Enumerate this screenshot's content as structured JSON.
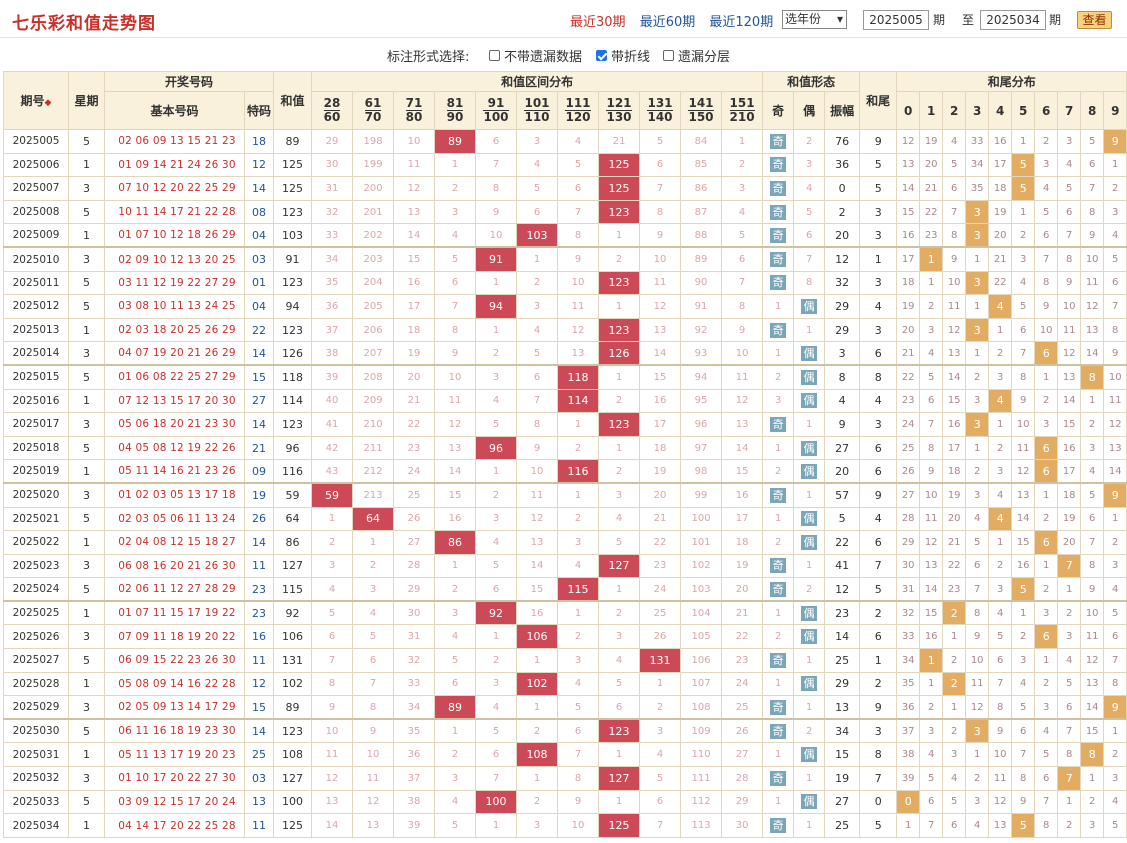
{
  "header": {
    "title": "七乐彩和值走势图",
    "periods": [
      "最近30期",
      "最近60期",
      "最近120期"
    ],
    "active_period": 0,
    "year_select": "选年份",
    "from_value": "2025005",
    "from_unit": "期",
    "to_label": "至",
    "to_value": "2025034",
    "to_unit": "期",
    "query_button": "查看"
  },
  "options": {
    "label": "标注形式选择:",
    "items": [
      {
        "label": "不带遗漏数据",
        "checked": false
      },
      {
        "label": "带折线",
        "checked": true
      },
      {
        "label": "遗漏分层",
        "checked": false
      }
    ]
  },
  "table_headers": {
    "issue": "期号",
    "week": "星期",
    "draw": "开奖号码",
    "basic": "基本号码",
    "special": "特码",
    "sum": "和值",
    "range_dist": "和值区间分布",
    "ranges": [
      [
        "28",
        "60"
      ],
      [
        "61",
        "70"
      ],
      [
        "71",
        "80"
      ],
      [
        "81",
        "90"
      ],
      [
        "91",
        "100"
      ],
      [
        "101",
        "110"
      ],
      [
        "111",
        "120"
      ],
      [
        "121",
        "130"
      ],
      [
        "131",
        "140"
      ],
      [
        "141",
        "150"
      ],
      [
        "151",
        "210"
      ]
    ],
    "form": "和值形态",
    "odd": "奇",
    "even": "偶",
    "amp": "振幅",
    "tail": "和尾",
    "tail_dist": "和尾分布",
    "tail_digits": [
      "0",
      "1",
      "2",
      "3",
      "4",
      "5",
      "6",
      "7",
      "8",
      "9"
    ]
  },
  "rows": [
    {
      "issue": "2025005",
      "week": "5",
      "nums": "02 06 09 13 15 21 23",
      "sp": "18",
      "sum": "89",
      "hit": 3,
      "ranges": [
        "29",
        "198",
        "10",
        "89",
        "6",
        "3",
        "4",
        "21",
        "5",
        "84",
        "1"
      ],
      "odd": "奇",
      "even_m": "2",
      "oe": "odd",
      "amp": "76",
      "tail": "9",
      "tails": [
        "12",
        "19",
        "4",
        "33",
        "16",
        "1",
        "2",
        "3",
        "5",
        "9"
      ]
    },
    {
      "issue": "2025006",
      "week": "1",
      "nums": "01 09 14 21 24 26 30",
      "sp": "12",
      "sum": "125",
      "hit": 7,
      "ranges": [
        "30",
        "199",
        "11",
        "1",
        "7",
        "4",
        "5",
        "125",
        "6",
        "85",
        "2"
      ],
      "odd": "奇",
      "even_m": "3",
      "oe": "odd",
      "amp": "36",
      "tail": "5",
      "tails": [
        "13",
        "20",
        "5",
        "34",
        "17",
        "5",
        "3",
        "4",
        "6",
        "1"
      ]
    },
    {
      "issue": "2025007",
      "week": "3",
      "nums": "07 10 12 20 22 25 29",
      "sp": "14",
      "sum": "125",
      "hit": 7,
      "ranges": [
        "31",
        "200",
        "12",
        "2",
        "8",
        "5",
        "6",
        "125",
        "7",
        "86",
        "3"
      ],
      "odd": "奇",
      "even_m": "4",
      "oe": "odd",
      "amp": "0",
      "tail": "5",
      "tails": [
        "14",
        "21",
        "6",
        "35",
        "18",
        "5",
        "4",
        "5",
        "7",
        "2"
      ]
    },
    {
      "issue": "2025008",
      "week": "5",
      "nums": "10 11 14 17 21 22 28",
      "sp": "08",
      "sum": "123",
      "hit": 7,
      "ranges": [
        "32",
        "201",
        "13",
        "3",
        "9",
        "6",
        "7",
        "123",
        "8",
        "87",
        "4"
      ],
      "odd": "奇",
      "even_m": "5",
      "oe": "odd",
      "amp": "2",
      "tail": "3",
      "tails": [
        "15",
        "22",
        "7",
        "3",
        "19",
        "1",
        "5",
        "6",
        "8",
        "3"
      ]
    },
    {
      "issue": "2025009",
      "week": "1",
      "nums": "01 07 10 12 18 26 29",
      "sp": "04",
      "sum": "103",
      "hit": 5,
      "ranges": [
        "33",
        "202",
        "14",
        "4",
        "10",
        "103",
        "8",
        "1",
        "9",
        "88",
        "5"
      ],
      "odd": "奇",
      "even_m": "6",
      "oe": "odd",
      "amp": "20",
      "tail": "3",
      "tails": [
        "16",
        "23",
        "8",
        "3",
        "20",
        "2",
        "6",
        "7",
        "9",
        "4"
      ]
    },
    {
      "issue": "2025010",
      "week": "3",
      "nums": "02 09 10 12 13 20 25",
      "sp": "03",
      "sum": "91",
      "hit": 4,
      "ranges": [
        "34",
        "203",
        "15",
        "5",
        "91",
        "1",
        "9",
        "2",
        "10",
        "89",
        "6"
      ],
      "odd": "奇",
      "even_m": "7",
      "oe": "odd",
      "amp": "12",
      "tail": "1",
      "tails": [
        "17",
        "1",
        "9",
        "1",
        "21",
        "3",
        "7",
        "8",
        "10",
        "5"
      ]
    },
    {
      "issue": "2025011",
      "week": "5",
      "nums": "03 11 12 19 22 27 29",
      "sp": "01",
      "sum": "123",
      "hit": 7,
      "ranges": [
        "35",
        "204",
        "16",
        "6",
        "1",
        "2",
        "10",
        "123",
        "11",
        "90",
        "7"
      ],
      "odd": "奇",
      "even_m": "8",
      "oe": "odd",
      "amp": "32",
      "tail": "3",
      "tails": [
        "18",
        "1",
        "10",
        "3",
        "22",
        "4",
        "8",
        "9",
        "11",
        "6"
      ]
    },
    {
      "issue": "2025012",
      "week": "5",
      "nums": "03 08 10 11 13 24 25",
      "sp": "04",
      "sum": "94",
      "hit": 4,
      "ranges": [
        "36",
        "205",
        "17",
        "7",
        "94",
        "3",
        "11",
        "1",
        "12",
        "91",
        "8"
      ],
      "odd": "1",
      "even_m": "偶",
      "oe": "even",
      "amp": "29",
      "tail": "4",
      "tails": [
        "19",
        "2",
        "11",
        "1",
        "4",
        "5",
        "9",
        "10",
        "12",
        "7"
      ]
    },
    {
      "issue": "2025013",
      "week": "1",
      "nums": "02 03 18 20 25 26 29",
      "sp": "22",
      "sum": "123",
      "hit": 7,
      "ranges": [
        "37",
        "206",
        "18",
        "8",
        "1",
        "4",
        "12",
        "123",
        "13",
        "92",
        "9"
      ],
      "odd": "奇",
      "even_m": "1",
      "oe": "odd",
      "amp": "29",
      "tail": "3",
      "tails": [
        "20",
        "3",
        "12",
        "3",
        "1",
        "6",
        "10",
        "11",
        "13",
        "8"
      ]
    },
    {
      "issue": "2025014",
      "week": "3",
      "nums": "04 07 19 20 21 26 29",
      "sp": "14",
      "sum": "126",
      "hit": 7,
      "ranges": [
        "38",
        "207",
        "19",
        "9",
        "2",
        "5",
        "13",
        "126",
        "14",
        "93",
        "10"
      ],
      "odd": "1",
      "even_m": "偶",
      "oe": "even",
      "amp": "3",
      "tail": "6",
      "tails": [
        "21",
        "4",
        "13",
        "1",
        "2",
        "7",
        "6",
        "12",
        "14",
        "9"
      ]
    },
    {
      "issue": "2025015",
      "week": "5",
      "nums": "01 06 08 22 25 27 29",
      "sp": "15",
      "sum": "118",
      "hit": 6,
      "ranges": [
        "39",
        "208",
        "20",
        "10",
        "3",
        "6",
        "118",
        "1",
        "15",
        "94",
        "11"
      ],
      "odd": "2",
      "even_m": "偶",
      "oe": "even",
      "amp": "8",
      "tail": "8",
      "tails": [
        "22",
        "5",
        "14",
        "2",
        "3",
        "8",
        "1",
        "13",
        "8",
        "10"
      ]
    },
    {
      "issue": "2025016",
      "week": "1",
      "nums": "07 12 13 15 17 20 30",
      "sp": "27",
      "sum": "114",
      "hit": 6,
      "ranges": [
        "40",
        "209",
        "21",
        "11",
        "4",
        "7",
        "114",
        "2",
        "16",
        "95",
        "12"
      ],
      "odd": "3",
      "even_m": "偶",
      "oe": "even",
      "amp": "4",
      "tail": "4",
      "tails": [
        "23",
        "6",
        "15",
        "3",
        "4",
        "9",
        "2",
        "14",
        "1",
        "11"
      ]
    },
    {
      "issue": "2025017",
      "week": "3",
      "nums": "05 06 18 20 21 23 30",
      "sp": "14",
      "sum": "123",
      "hit": 7,
      "ranges": [
        "41",
        "210",
        "22",
        "12",
        "5",
        "8",
        "1",
        "123",
        "17",
        "96",
        "13"
      ],
      "odd": "奇",
      "even_m": "1",
      "oe": "odd",
      "amp": "9",
      "tail": "3",
      "tails": [
        "24",
        "7",
        "16",
        "3",
        "1",
        "10",
        "3",
        "15",
        "2",
        "12"
      ]
    },
    {
      "issue": "2025018",
      "week": "5",
      "nums": "04 05 08 12 19 22 26",
      "sp": "21",
      "sum": "96",
      "hit": 4,
      "ranges": [
        "42",
        "211",
        "23",
        "13",
        "96",
        "9",
        "2",
        "1",
        "18",
        "97",
        "14"
      ],
      "odd": "1",
      "even_m": "偶",
      "oe": "even",
      "amp": "27",
      "tail": "6",
      "tails": [
        "25",
        "8",
        "17",
        "1",
        "2",
        "11",
        "6",
        "16",
        "3",
        "13"
      ]
    },
    {
      "issue": "2025019",
      "week": "1",
      "nums": "05 11 14 16 21 23 26",
      "sp": "09",
      "sum": "116",
      "hit": 6,
      "ranges": [
        "43",
        "212",
        "24",
        "14",
        "1",
        "10",
        "116",
        "2",
        "19",
        "98",
        "15"
      ],
      "odd": "2",
      "even_m": "偶",
      "oe": "even",
      "amp": "20",
      "tail": "6",
      "tails": [
        "26",
        "9",
        "18",
        "2",
        "3",
        "12",
        "6",
        "17",
        "4",
        "14"
      ]
    },
    {
      "issue": "2025020",
      "week": "3",
      "nums": "01 02 03 05 13 17 18",
      "sp": "19",
      "sum": "59",
      "hit": 0,
      "ranges": [
        "59",
        "213",
        "25",
        "15",
        "2",
        "11",
        "1",
        "3",
        "20",
        "99",
        "16"
      ],
      "odd": "奇",
      "even_m": "1",
      "oe": "odd",
      "amp": "57",
      "tail": "9",
      "tails": [
        "27",
        "10",
        "19",
        "3",
        "4",
        "13",
        "1",
        "18",
        "5",
        "9"
      ]
    },
    {
      "issue": "2025021",
      "week": "5",
      "nums": "02 03 05 06 11 13 24",
      "sp": "26",
      "sum": "64",
      "hit": 1,
      "ranges": [
        "1",
        "64",
        "26",
        "16",
        "3",
        "12",
        "2",
        "4",
        "21",
        "100",
        "17"
      ],
      "odd": "1",
      "even_m": "偶",
      "oe": "even",
      "amp": "5",
      "tail": "4",
      "tails": [
        "28",
        "11",
        "20",
        "4",
        "4",
        "14",
        "2",
        "19",
        "6",
        "1"
      ]
    },
    {
      "issue": "2025022",
      "week": "1",
      "nums": "02 04 08 12 15 18 27",
      "sp": "14",
      "sum": "86",
      "hit": 3,
      "ranges": [
        "2",
        "1",
        "27",
        "86",
        "4",
        "13",
        "3",
        "5",
        "22",
        "101",
        "18"
      ],
      "odd": "2",
      "even_m": "偶",
      "oe": "even",
      "amp": "22",
      "tail": "6",
      "tails": [
        "29",
        "12",
        "21",
        "5",
        "1",
        "15",
        "6",
        "20",
        "7",
        "2"
      ]
    },
    {
      "issue": "2025023",
      "week": "3",
      "nums": "06 08 16 20 21 26 30",
      "sp": "11",
      "sum": "127",
      "hit": 7,
      "ranges": [
        "3",
        "2",
        "28",
        "1",
        "5",
        "14",
        "4",
        "127",
        "23",
        "102",
        "19"
      ],
      "odd": "奇",
      "even_m": "1",
      "oe": "odd",
      "amp": "41",
      "tail": "7",
      "tails": [
        "30",
        "13",
        "22",
        "6",
        "2",
        "16",
        "1",
        "7",
        "8",
        "3"
      ]
    },
    {
      "issue": "2025024",
      "week": "5",
      "nums": "02 06 11 12 27 28 29",
      "sp": "23",
      "sum": "115",
      "hit": 6,
      "ranges": [
        "4",
        "3",
        "29",
        "2",
        "6",
        "15",
        "115",
        "1",
        "24",
        "103",
        "20"
      ],
      "odd": "奇",
      "even_m": "2",
      "oe": "odd",
      "amp": "12",
      "tail": "5",
      "tails": [
        "31",
        "14",
        "23",
        "7",
        "3",
        "5",
        "2",
        "1",
        "9",
        "4"
      ]
    },
    {
      "issue": "2025025",
      "week": "1",
      "nums": "01 07 11 15 17 19 22",
      "sp": "23",
      "sum": "92",
      "hit": 4,
      "ranges": [
        "5",
        "4",
        "30",
        "3",
        "92",
        "16",
        "1",
        "2",
        "25",
        "104",
        "21"
      ],
      "odd": "1",
      "even_m": "偶",
      "oe": "even",
      "amp": "23",
      "tail": "2",
      "tails": [
        "32",
        "15",
        "2",
        "8",
        "4",
        "1",
        "3",
        "2",
        "10",
        "5"
      ]
    },
    {
      "issue": "2025026",
      "week": "3",
      "nums": "07 09 11 18 19 20 22",
      "sp": "16",
      "sum": "106",
      "hit": 5,
      "ranges": [
        "6",
        "5",
        "31",
        "4",
        "1",
        "106",
        "2",
        "3",
        "26",
        "105",
        "22"
      ],
      "odd": "2",
      "even_m": "偶",
      "oe": "even",
      "amp": "14",
      "tail": "6",
      "tails": [
        "33",
        "16",
        "1",
        "9",
        "5",
        "2",
        "6",
        "3",
        "11",
        "6"
      ]
    },
    {
      "issue": "2025027",
      "week": "5",
      "nums": "06 09 15 22 23 26 30",
      "sp": "11",
      "sum": "131",
      "hit": 8,
      "ranges": [
        "7",
        "6",
        "32",
        "5",
        "2",
        "1",
        "3",
        "4",
        "131",
        "106",
        "23"
      ],
      "odd": "奇",
      "even_m": "1",
      "oe": "odd",
      "amp": "25",
      "tail": "1",
      "tails": [
        "34",
        "1",
        "2",
        "10",
        "6",
        "3",
        "1",
        "4",
        "12",
        "7"
      ]
    },
    {
      "issue": "2025028",
      "week": "1",
      "nums": "05 08 09 14 16 22 28",
      "sp": "12",
      "sum": "102",
      "hit": 5,
      "ranges": [
        "8",
        "7",
        "33",
        "6",
        "3",
        "102",
        "4",
        "5",
        "1",
        "107",
        "24"
      ],
      "odd": "1",
      "even_m": "偶",
      "oe": "even",
      "amp": "29",
      "tail": "2",
      "tails": [
        "35",
        "1",
        "2",
        "11",
        "7",
        "4",
        "2",
        "5",
        "13",
        "8"
      ]
    },
    {
      "issue": "2025029",
      "week": "3",
      "nums": "02 05 09 13 14 17 29",
      "sp": "15",
      "sum": "89",
      "hit": 3,
      "ranges": [
        "9",
        "8",
        "34",
        "89",
        "4",
        "1",
        "5",
        "6",
        "2",
        "108",
        "25"
      ],
      "odd": "奇",
      "even_m": "1",
      "oe": "odd",
      "amp": "13",
      "tail": "9",
      "tails": [
        "36",
        "2",
        "1",
        "12",
        "8",
        "5",
        "3",
        "6",
        "14",
        "9"
      ]
    },
    {
      "issue": "2025030",
      "week": "5",
      "nums": "06 11 16 18 19 23 30",
      "sp": "14",
      "sum": "123",
      "hit": 7,
      "ranges": [
        "10",
        "9",
        "35",
        "1",
        "5",
        "2",
        "6",
        "123",
        "3",
        "109",
        "26"
      ],
      "odd": "奇",
      "even_m": "2",
      "oe": "odd",
      "amp": "34",
      "tail": "3",
      "tails": [
        "37",
        "3",
        "2",
        "3",
        "9",
        "6",
        "4",
        "7",
        "15",
        "1"
      ]
    },
    {
      "issue": "2025031",
      "week": "1",
      "nums": "05 11 13 17 19 20 23",
      "sp": "25",
      "sum": "108",
      "hit": 5,
      "ranges": [
        "11",
        "10",
        "36",
        "2",
        "6",
        "108",
        "7",
        "1",
        "4",
        "110",
        "27"
      ],
      "odd": "1",
      "even_m": "偶",
      "oe": "even",
      "amp": "15",
      "tail": "8",
      "tails": [
        "38",
        "4",
        "3",
        "1",
        "10",
        "7",
        "5",
        "8",
        "8",
        "2"
      ]
    },
    {
      "issue": "2025032",
      "week": "3",
      "nums": "01 10 17 20 22 27 30",
      "sp": "03",
      "sum": "127",
      "hit": 7,
      "ranges": [
        "12",
        "11",
        "37",
        "3",
        "7",
        "1",
        "8",
        "127",
        "5",
        "111",
        "28"
      ],
      "odd": "奇",
      "even_m": "1",
      "oe": "odd",
      "amp": "19",
      "tail": "7",
      "tails": [
        "39",
        "5",
        "4",
        "2",
        "11",
        "8",
        "6",
        "7",
        "1",
        "3"
      ]
    },
    {
      "issue": "2025033",
      "week": "5",
      "nums": "03 09 12 15 17 20 24",
      "sp": "13",
      "sum": "100",
      "hit": 4,
      "ranges": [
        "13",
        "12",
        "38",
        "4",
        "100",
        "2",
        "9",
        "1",
        "6",
        "112",
        "29"
      ],
      "odd": "1",
      "even_m": "偶",
      "oe": "even",
      "amp": "27",
      "tail": "0",
      "tails": [
        "0",
        "6",
        "5",
        "3",
        "12",
        "9",
        "7",
        "1",
        "2",
        "4"
      ]
    },
    {
      "issue": "2025034",
      "week": "1",
      "nums": "04 14 17 20 22 25 28",
      "sp": "11",
      "sum": "125",
      "hit": 7,
      "ranges": [
        "14",
        "13",
        "39",
        "5",
        "1",
        "3",
        "10",
        "125",
        "7",
        "113",
        "30"
      ],
      "odd": "奇",
      "even_m": "1",
      "oe": "odd",
      "amp": "25",
      "tail": "5",
      "tails": [
        "1",
        "7",
        "6",
        "4",
        "13",
        "5",
        "8",
        "2",
        "3",
        "5"
      ]
    }
  ]
}
